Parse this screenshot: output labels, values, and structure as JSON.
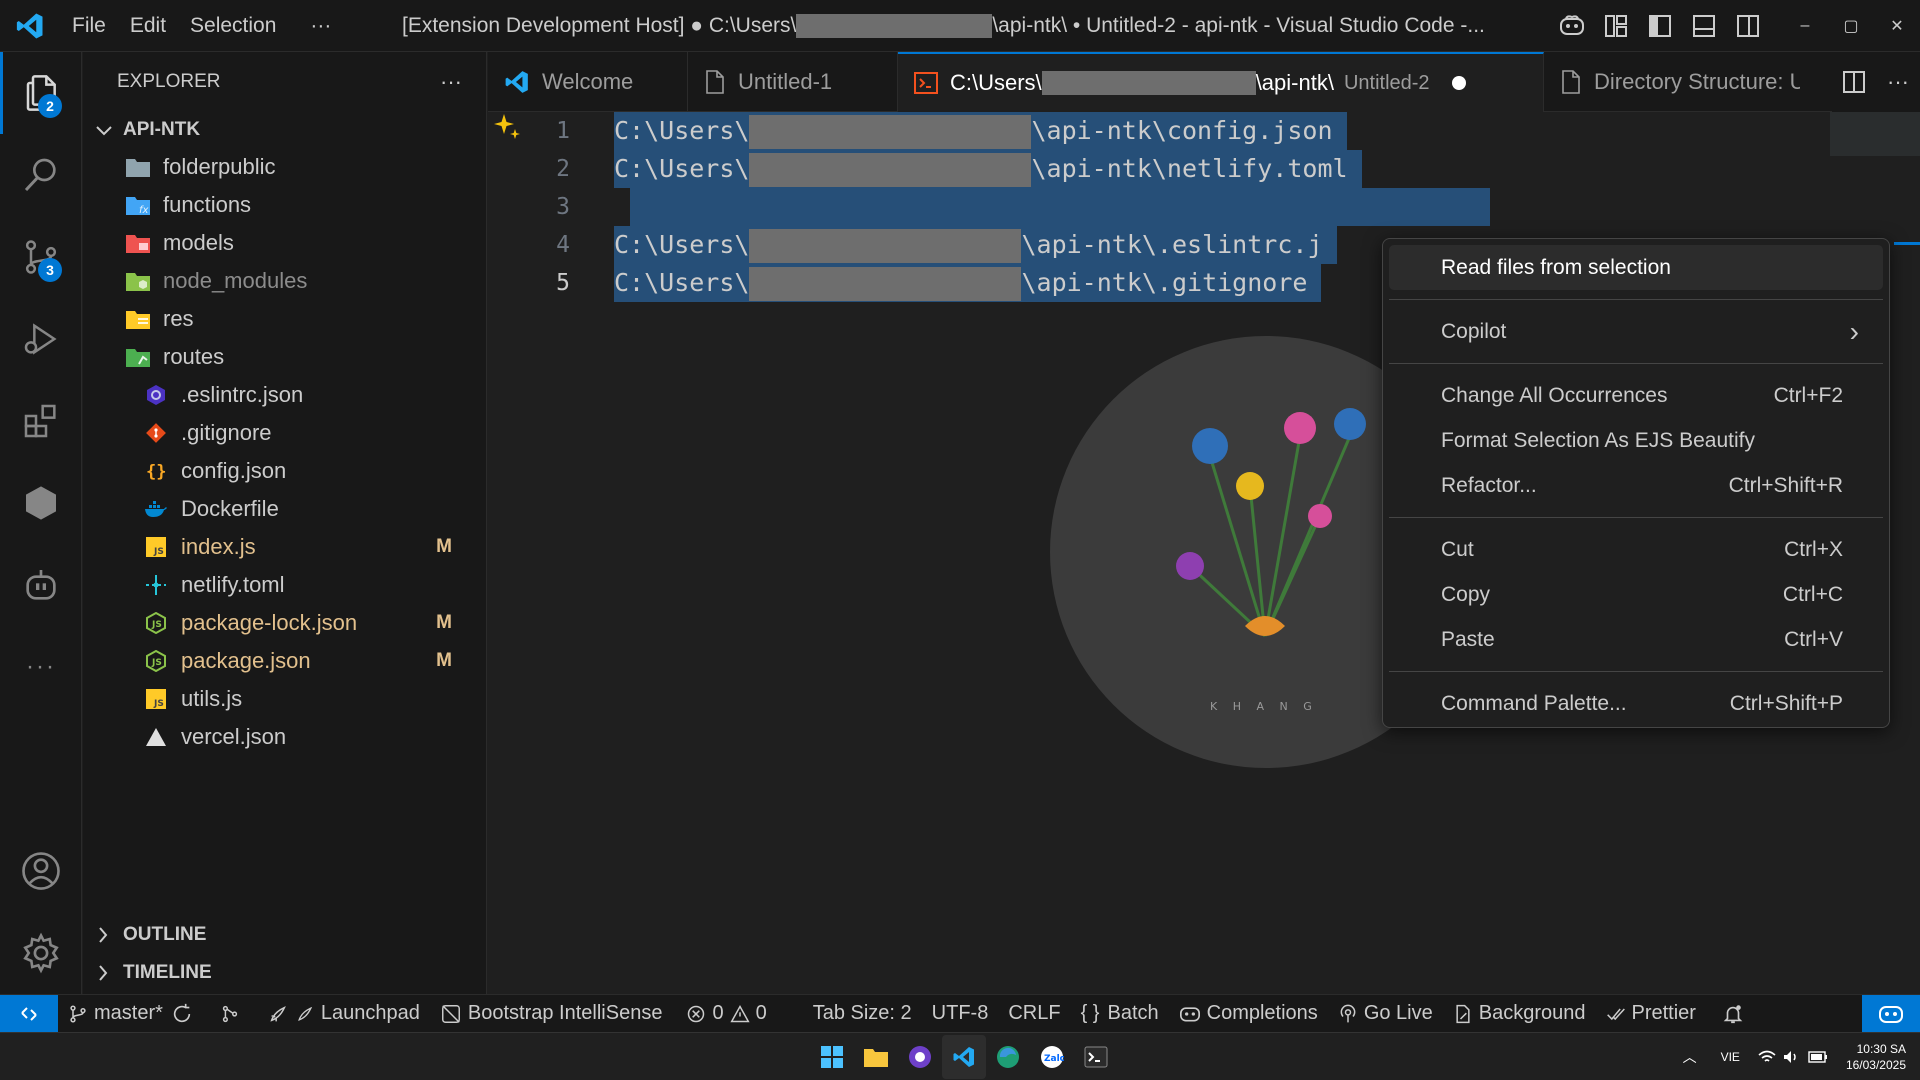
{
  "titlebar": {
    "menu": [
      "File",
      "Edit",
      "Selection",
      "···"
    ],
    "title_prefix": "[Extension Development Host] ● C:\\Users\\",
    "title_suffix": "\\api-ntk\\ • Untitled-2 - api-ntk - Visual Studio Code -...",
    "window_controls": [
      "–",
      "▢",
      "✕"
    ]
  },
  "activitybar": {
    "explorer_badge": "2",
    "scm_badge": "3",
    "more": "···"
  },
  "sidebar": {
    "title": "EXPLORER",
    "more": "···",
    "root": "API-NTK",
    "folders": [
      {
        "label": "folderpublic",
        "color": "#90a4ae"
      },
      {
        "label": "functions",
        "color": "#42a5f5"
      },
      {
        "label": "models",
        "color": "#ef5350"
      },
      {
        "label": "node_modules",
        "color": "#8bc34a"
      },
      {
        "label": "res",
        "color": "#ffca28"
      },
      {
        "label": "routes",
        "color": "#4caf50"
      }
    ],
    "files": [
      {
        "label": ".eslintrc.json",
        "icon": "eslint-icon",
        "badge": ""
      },
      {
        "label": ".gitignore",
        "icon": "git-icon",
        "badge": ""
      },
      {
        "label": "config.json",
        "icon": "json-icon",
        "badge": ""
      },
      {
        "label": "Dockerfile",
        "icon": "docker-icon",
        "badge": ""
      },
      {
        "label": "index.js",
        "icon": "js-icon",
        "badge": "M"
      },
      {
        "label": "netlify.toml",
        "icon": "netlify-icon",
        "badge": ""
      },
      {
        "label": "package-lock.json",
        "icon": "nodejs-icon",
        "badge": "M"
      },
      {
        "label": "package.json",
        "icon": "nodejs-icon",
        "badge": "M"
      },
      {
        "label": "utils.js",
        "icon": "js-icon",
        "badge": ""
      },
      {
        "label": "vercel.json",
        "icon": "vercel-icon",
        "badge": ""
      }
    ],
    "outline": "OUTLINE",
    "timeline": "TIMELINE"
  },
  "tabs": [
    {
      "label": "Welcome"
    },
    {
      "label": "Untitled-1"
    },
    {
      "label_prefix": "C:\\Users\\",
      "label_suffix": "\\api-ntk\\",
      "sub": "Untitled-2"
    },
    {
      "label": "Directory Structure: U"
    }
  ],
  "editor": {
    "lines": [
      {
        "num": "1",
        "prefix": "C:\\Users\\",
        "suffix": "\\api-ntk\\config.json"
      },
      {
        "num": "2",
        "prefix": "C:\\Users\\",
        "suffix": "\\api-ntk\\netlify.toml"
      },
      {
        "num": "3",
        "prefix": "",
        "suffix": ""
      },
      {
        "num": "4",
        "prefix": "C:\\Users\\",
        "suffix": "\\api-ntk\\.eslintrc.j"
      },
      {
        "num": "5",
        "prefix": "C:\\Users\\",
        "suffix": "\\api-ntk\\.gitignore"
      }
    ],
    "current_line": "5"
  },
  "context_menu": {
    "items": [
      {
        "label": "Read files from selection",
        "shortcut": ""
      },
      {
        "label": "Copilot",
        "shortcut": "›"
      },
      {
        "label": "Change All Occurrences",
        "shortcut": "Ctrl+F2"
      },
      {
        "label": "Format Selection As EJS Beautify",
        "shortcut": ""
      },
      {
        "label": "Refactor...",
        "shortcut": "Ctrl+Shift+R"
      },
      {
        "label": "Cut",
        "shortcut": "Ctrl+X"
      },
      {
        "label": "Copy",
        "shortcut": "Ctrl+C"
      },
      {
        "label": "Paste",
        "shortcut": "Ctrl+V"
      },
      {
        "label": "Command Palette...",
        "shortcut": "Ctrl+Shift+P"
      }
    ]
  },
  "wallpaper": {
    "caption": "K H A N G"
  },
  "statusbar": {
    "branch": "master*",
    "launchpad": "Launchpad",
    "bootstrap": "Bootstrap IntelliSense",
    "errors": "0",
    "warnings": "0",
    "tab_size": "Tab Size: 2",
    "encoding": "UTF-8",
    "eol": "CRLF",
    "language": "Batch",
    "completions": "Completions",
    "golive": "Go Live",
    "background": "Background",
    "prettier": "Prettier"
  },
  "taskbar": {
    "lang": "VIE",
    "time": "10:30 SA",
    "date": "16/03/2025"
  },
  "colors": {
    "accent": "#0078d4",
    "modified": "#e2c08d",
    "selection": "#264f78"
  }
}
